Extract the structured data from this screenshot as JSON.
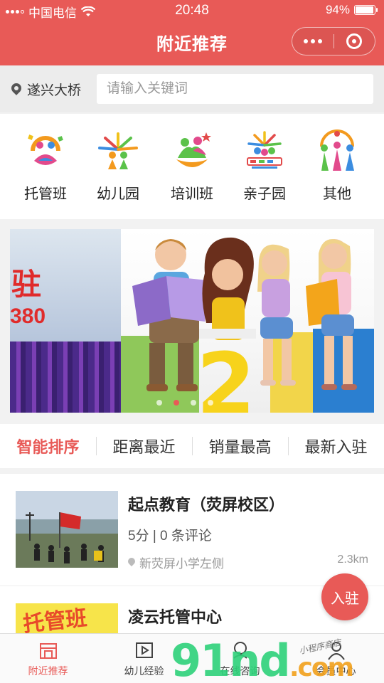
{
  "status_bar": {
    "carrier": "中国电信",
    "time": "20:48",
    "battery": "94%"
  },
  "nav": {
    "title": "附近推荐"
  },
  "search": {
    "location": "遂兴大桥",
    "placeholder": "请输入关键词"
  },
  "categories": [
    {
      "label": "托管班",
      "icon": "childcare-icon"
    },
    {
      "label": "幼儿园",
      "icon": "kindergarten-icon"
    },
    {
      "label": "培训班",
      "icon": "training-icon"
    },
    {
      "label": "亲子园",
      "icon": "parent-child-icon"
    },
    {
      "label": "其他",
      "icon": "other-icon"
    }
  ],
  "banner": {
    "left_slide_text": "驻",
    "left_slide_number": "380",
    "main_number": "2",
    "dot_count": 4,
    "active_dot": 1
  },
  "sort_tabs": [
    {
      "label": "智能排序",
      "active": true
    },
    {
      "label": "距离最近",
      "active": false
    },
    {
      "label": "销量最高",
      "active": false
    },
    {
      "label": "最新入驻",
      "active": false
    }
  ],
  "listings": [
    {
      "title": "起点教育（荧屏校区）",
      "rating": "5分 | 0 条评论",
      "address": "新荧屏小学左侧",
      "distance": "2.3km"
    },
    {
      "title": "凌云托管中心",
      "thumb_text": "托管班"
    }
  ],
  "fab": {
    "label": "入驻"
  },
  "tab_bar": [
    {
      "label": "附近推荐",
      "icon": "store-icon",
      "active": true
    },
    {
      "label": "幼儿经验",
      "icon": "video-icon",
      "active": false
    },
    {
      "label": "在线咨询",
      "icon": "chat-icon",
      "active": false
    },
    {
      "label": "会员中心",
      "icon": "user-icon",
      "active": false
    }
  ],
  "watermark": {
    "main": "91nd",
    "suffix": ".com",
    "sub": "小程序商店"
  },
  "colors": {
    "brand": "#e85a57",
    "watermark_green": "#2ed27a",
    "watermark_orange": "#f2a11c"
  }
}
